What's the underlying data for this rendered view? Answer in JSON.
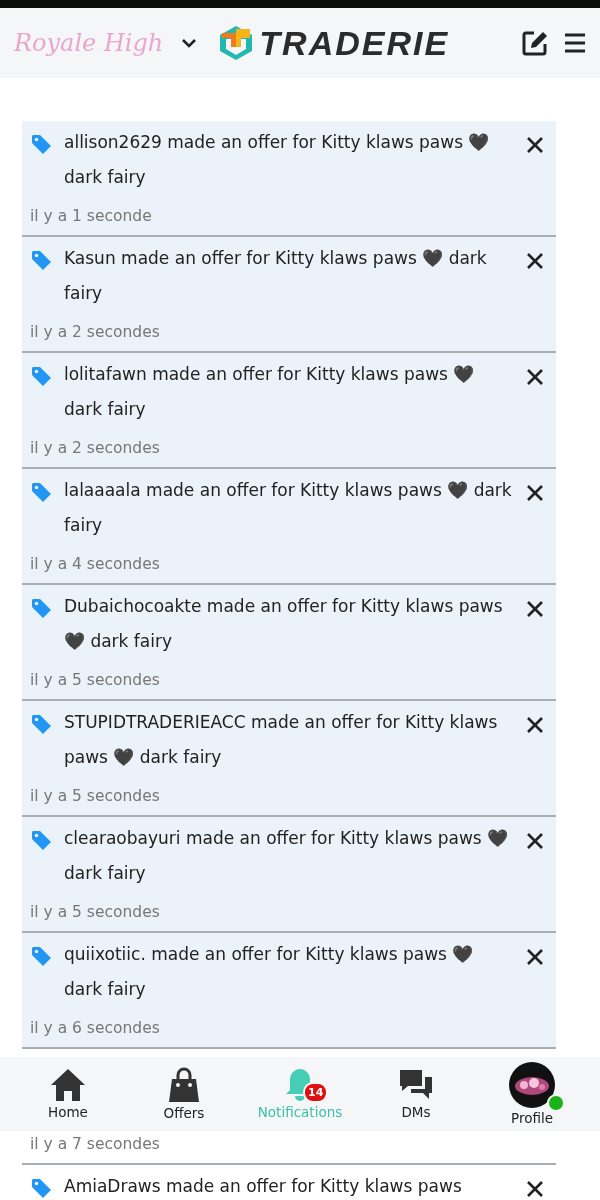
{
  "header": {
    "game": "Royale High",
    "brand": "TRADERIE"
  },
  "notifications": [
    {
      "text": "allison2629 made an offer for Kitty klaws paws 🖤 dark fairy",
      "time": "il y a 1 seconde",
      "unread": true
    },
    {
      "text": "Kasun made an offer for Kitty klaws paws 🖤 dark fairy",
      "time": "il y a 2 secondes",
      "unread": true
    },
    {
      "text": "lolitafawn made an offer for Kitty klaws paws 🖤 dark fairy",
      "time": "il y a 2 secondes",
      "unread": true
    },
    {
      "text": "lalaaaala made an offer for Kitty klaws paws 🖤 dark fairy",
      "time": "il y a 4 secondes",
      "unread": true
    },
    {
      "text": "Dubaichocoakte made an offer for Kitty klaws paws 🖤 dark fairy",
      "time": "il y a 5 secondes",
      "unread": true
    },
    {
      "text": "STUPIDTRADERIEACC made an offer for Kitty klaws paws 🖤 dark fairy",
      "time": "il y a 5 secondes",
      "unread": true
    },
    {
      "text": "clearaobayuri made an offer for Kitty klaws paws 🖤 dark fairy",
      "time": "il y a 5 secondes",
      "unread": true
    },
    {
      "text": "quiixotiic. made an offer for Kitty klaws paws 🖤 dark fairy",
      "time": "il y a 6 secondes",
      "unread": true
    },
    {
      "time": "il y a 7 secondes",
      "unread": false
    },
    {
      "text": "AmiaDraws made an offer for Kitty klaws paws",
      "unread": false
    }
  ],
  "bottom_nav": [
    {
      "kind": "home",
      "label": "Home",
      "selected": false
    },
    {
      "kind": "offers",
      "label": "Offers",
      "selected": false
    },
    {
      "kind": "notifications",
      "label": "Notifications",
      "selected": true,
      "badge": "14"
    },
    {
      "kind": "dms",
      "label": "DMs",
      "selected": false
    },
    {
      "kind": "profile",
      "label": "Profile",
      "selected": false,
      "online": true
    }
  ]
}
